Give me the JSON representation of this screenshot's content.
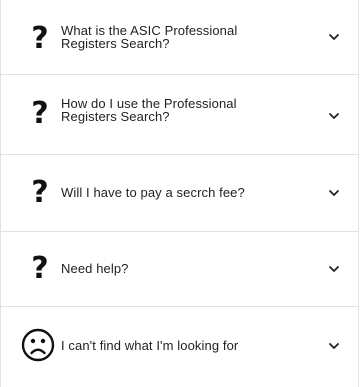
{
  "faq": {
    "items": [
      {
        "label_line1": "What is the ASIC Professional",
        "label_line2": "Registers Search?",
        "icon": "question-mark-icon"
      },
      {
        "label_line1": "How do I use the Professional",
        "label_line2": "Registers Search?",
        "icon": "question-mark-icon"
      },
      {
        "label_line1": "Will I have to pay a secrch fee?",
        "label_line2": "",
        "icon": "question-mark-icon"
      },
      {
        "label_line1": "Need help?",
        "label_line2": "",
        "icon": "question-mark-icon"
      },
      {
        "label_line1": "I can't find what I'm looking for",
        "label_line2": "",
        "icon": "sad-face-icon"
      }
    ],
    "question_glyph": "?",
    "expand_icon": "chevron-down-icon"
  }
}
